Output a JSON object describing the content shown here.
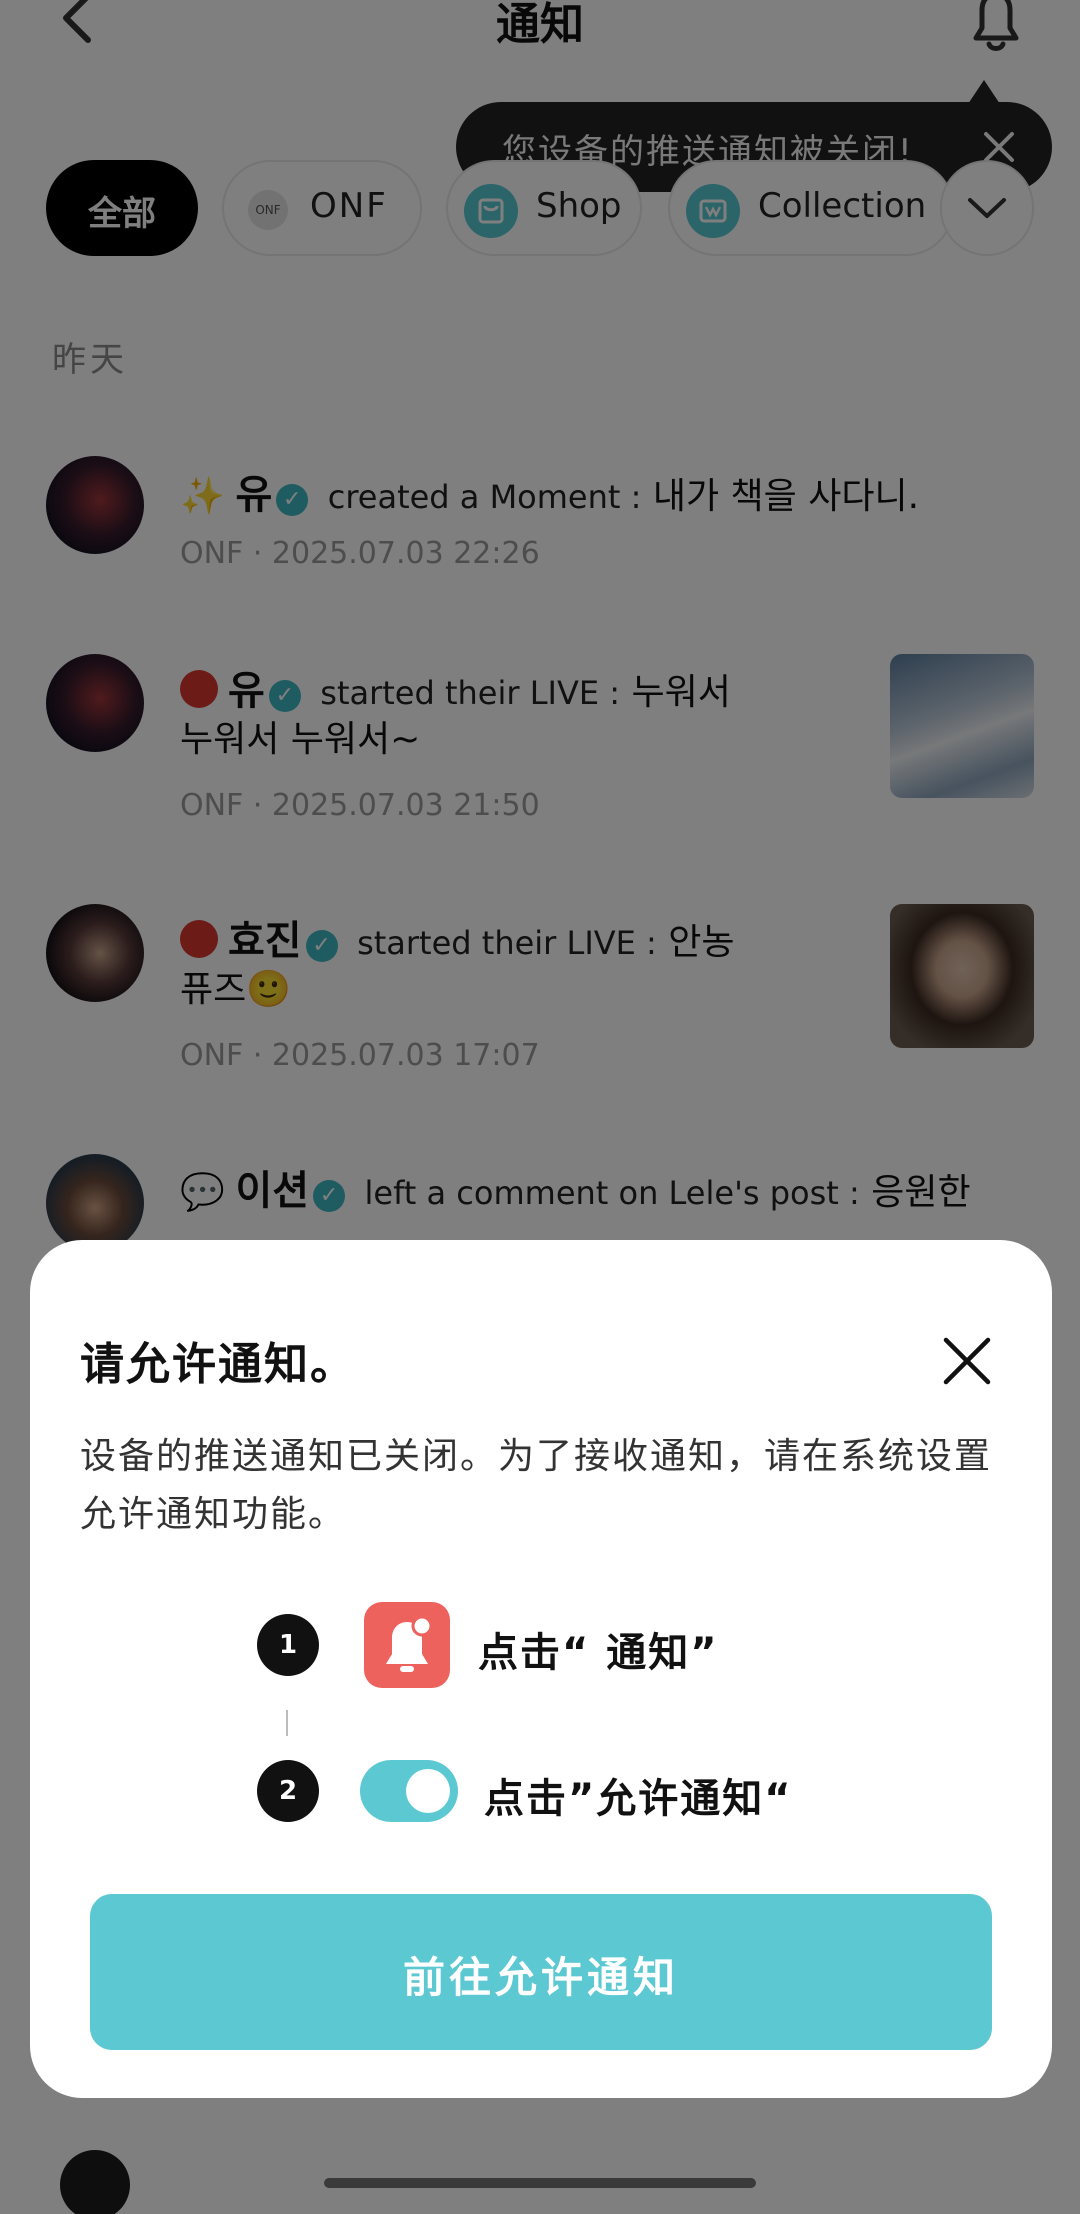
{
  "header": {
    "title": "通知"
  },
  "toast": {
    "text": "您设备的推送通知被关闭!"
  },
  "filters": {
    "chips": [
      {
        "label": "全部",
        "selected": true
      },
      {
        "label": "ONF",
        "icon_text": "ONF"
      },
      {
        "label": "Shop"
      },
      {
        "label": "Collection"
      }
    ]
  },
  "section": {
    "label": "昨天"
  },
  "notifications": [
    {
      "emoji": "✨",
      "user": "유",
      "action": "created a Moment :",
      "content_line1": "내가 책을 사다니.",
      "content_line2": "",
      "meta": "ONF · 2025.07.03 22:26",
      "has_thumbnail": false
    },
    {
      "emoji": "red-circle",
      "user": "유",
      "action": "started their LIVE :",
      "content_line1": "누워서",
      "content_line2": "누워서 누워서~",
      "meta": "ONF · 2025.07.03 21:50",
      "has_thumbnail": true
    },
    {
      "emoji": "red-circle",
      "user": "효진",
      "action": "started their LIVE :",
      "content_line1": "안농",
      "content_line2": "퓨즈🙂",
      "meta": "ONF · 2025.07.03 17:07",
      "has_thumbnail": true
    },
    {
      "emoji": "💬",
      "user": "이션",
      "action": "left a comment on Lele's post :",
      "content_line1": "응원한",
      "content_line2": "",
      "meta": "",
      "has_thumbnail": false
    }
  ],
  "dialog": {
    "title": "请允许通知。",
    "description": "设备的推送通知已关闭。为了接收通知，请在系统设置允许通知功能。",
    "steps": [
      {
        "number": "1",
        "text": "点击“ 通知”",
        "icon": "bell-app-icon"
      },
      {
        "number": "2",
        "text": "点击”允许通知“",
        "icon": "toggle-switch-icon"
      }
    ],
    "cta_label": "前往允许通知"
  },
  "colors": {
    "accent": "#5bc8d2",
    "bell_tile": "#ee625e",
    "live_dot": "#d9362f",
    "verified": "#3fb8c4"
  }
}
